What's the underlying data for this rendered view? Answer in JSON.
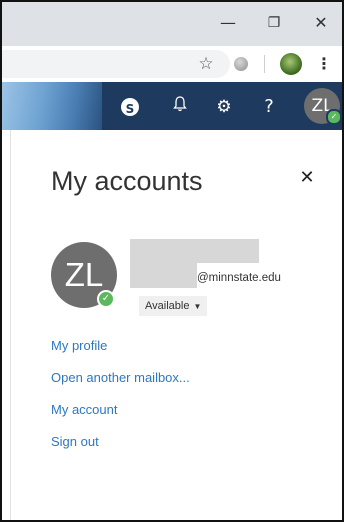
{
  "window": {
    "minimize_glyph": "—",
    "restore_glyph": "❐",
    "close_glyph": "✕"
  },
  "browser": {
    "star_glyph": "☆",
    "menu_glyph": "⋮"
  },
  "header": {
    "skype_letter": "S",
    "bell_glyph": "🔔",
    "gear_glyph": "⚙",
    "help_glyph": "?",
    "avatar_initials": "ZL",
    "presence_glyph": "✓"
  },
  "panel": {
    "title": "My accounts",
    "close_glyph": "✕",
    "account": {
      "initials": "ZL",
      "presence_glyph": "✓",
      "email_domain": "@minnstate.edu",
      "status": "Available"
    },
    "links": {
      "profile": "My profile",
      "open_mailbox": "Open another mailbox...",
      "account": "My account",
      "sign_out": "Sign out"
    }
  },
  "colors": {
    "appbar": "#1f3a5f",
    "link": "#2b78c5",
    "presence": "#5cb85c"
  }
}
